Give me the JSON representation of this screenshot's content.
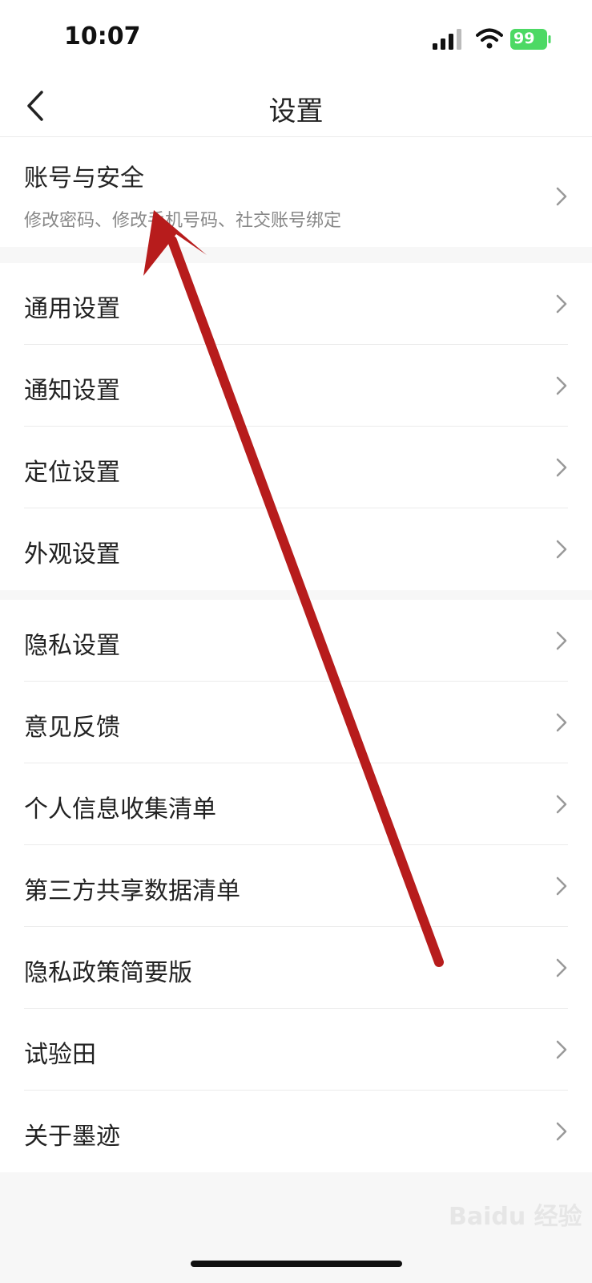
{
  "status_bar": {
    "time": "10:07",
    "battery": "99"
  },
  "header": {
    "title": "设置",
    "back_icon": "chevron-left-icon"
  },
  "account": {
    "title": "账号与安全",
    "subtitle": "修改密码、修改手机号码、社交账号绑定"
  },
  "group1": [
    {
      "label": "通用设置"
    },
    {
      "label": "通知设置"
    },
    {
      "label": "定位设置"
    },
    {
      "label": "外观设置"
    }
  ],
  "group2": [
    {
      "label": "隐私设置"
    },
    {
      "label": "意见反馈"
    },
    {
      "label": "个人信息收集清单"
    },
    {
      "label": "第三方共享数据清单"
    },
    {
      "label": "隐私政策简要版"
    },
    {
      "label": "试验田"
    },
    {
      "label": "关于墨迹"
    }
  ],
  "watermark": "Baidu 经验",
  "colors": {
    "annotation_arrow": "#b71c1c",
    "battery": "#4cd964"
  }
}
